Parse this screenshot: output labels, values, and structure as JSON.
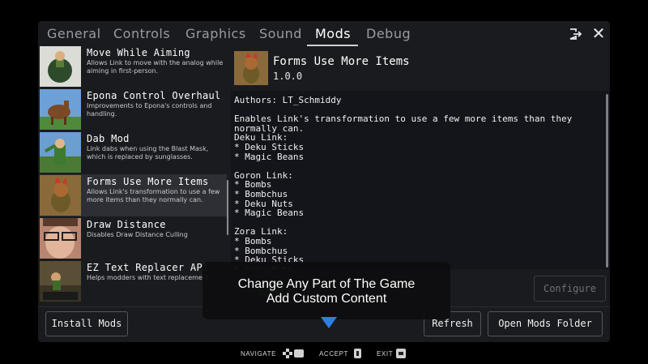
{
  "tabs": [
    {
      "label": "General"
    },
    {
      "label": "Controls"
    },
    {
      "label": "Graphics"
    },
    {
      "label": "Sound"
    },
    {
      "label": "Mods"
    },
    {
      "label": "Debug"
    }
  ],
  "active_tab": "Mods",
  "window_icons": {
    "exit": "exit-icon",
    "close": "close-icon",
    "close_glyph": "✕"
  },
  "mods": [
    {
      "title": "Move While Aiming",
      "description": "Allows Link to move with the analog while aiming in first-person."
    },
    {
      "title": "Epona Control Overhaul",
      "description": "Improvements to Epona's controls and handling."
    },
    {
      "title": "Dab Mod",
      "description": "Link dabs when using the Blast Mask, which is replaced by sunglasses."
    },
    {
      "title": "Forms Use More Items",
      "description": "Allows Link's transformation to use a few more items than they normally can."
    },
    {
      "title": "Draw Distance",
      "description": "Disables Draw Distance Culling"
    },
    {
      "title": "EZ Text Replacer API",
      "description": "Helps modders with text replacement."
    }
  ],
  "selected_mod_index": 3,
  "detail": {
    "title": "Forms Use More Items",
    "version": "1.0.0",
    "body": "Authors: LT_Schmiddy\n\nEnables Link's transformation to use a few more items than they\nnormally can.\nDeku Link:\n* Deku Sticks\n* Magic Beans\n\nGoron Link:\n* Bombs\n* Bombchus\n* Deku Nuts\n* Magic Beans\n\nZora Link:\n* Bombs\n* Bombchus\n* Deku Sticks\n* Deku Nuts"
  },
  "buttons": {
    "configure": "Configure",
    "install": "Install Mods",
    "refresh": "Refresh",
    "open_folder": "Open Mods Folder"
  },
  "tooltip": {
    "line1": "Change Any Part of The Game",
    "line2": "Add Custom Content"
  },
  "hints": {
    "navigate": "NAVIGATE",
    "accept": "ACCEPT",
    "exit": "EXIT"
  },
  "colors": {
    "accent_arrow": "#2f7fe0",
    "toggle_on": "#3a6b33",
    "panel_bg": "#1a1b1f"
  }
}
